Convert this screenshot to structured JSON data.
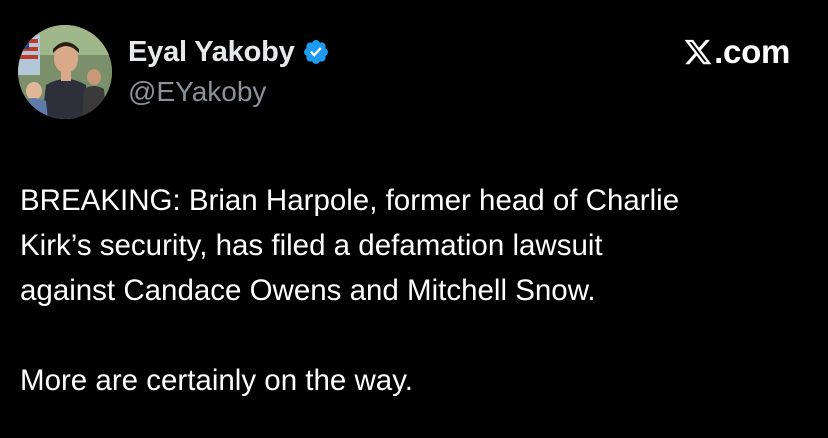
{
  "author": {
    "display_name": "Eyal Yakoby",
    "handle": "@EYakoby",
    "verified_icon": "verified-badge-icon",
    "verified_color": "#1d9bf0"
  },
  "brand": {
    "icon": "x-logo-icon",
    "domain": ".com"
  },
  "tweet": {
    "paragraph_1_lines": [
      "BREAKING: Brian Harpole, former head of Charlie",
      "Kirk’s security, has filed a defamation lawsuit",
      "against Candace Owens and Mitchell Snow."
    ],
    "paragraph_2": "More are certainly on the way."
  },
  "colors": {
    "background": "#000000",
    "text": "#ffffff",
    "secondary_text": "#8b9197"
  }
}
